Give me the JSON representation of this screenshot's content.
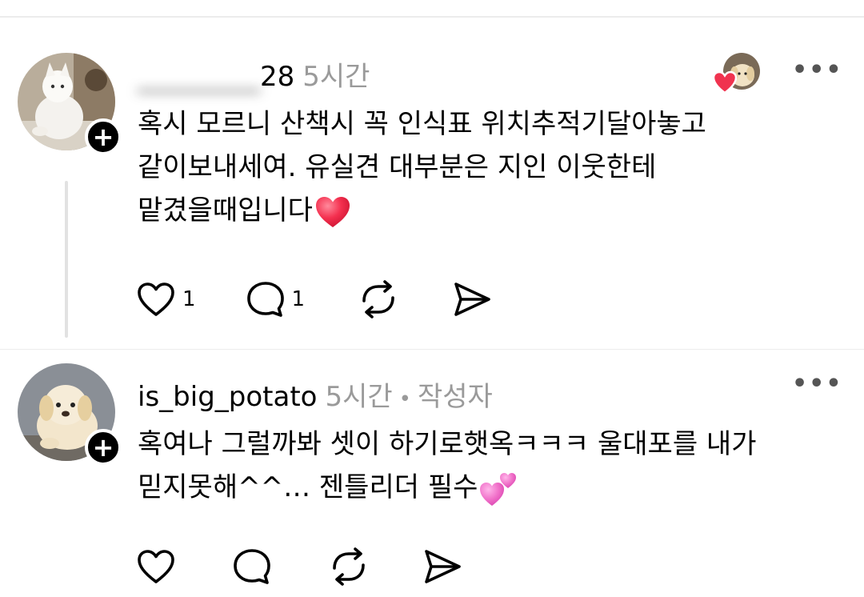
{
  "comments": [
    {
      "username_visible_tail": "28",
      "username_blurred": "_________",
      "time": "5시간",
      "lines": [
        "혹시 모르니 산책시 꼭 인식표 위치추적기달아놓고",
        "같이보내세여. 유실견 대부분은 지인 이웃한테",
        "맡겼을때입니다"
      ],
      "line3_emoji": "red-heart",
      "likes": "1",
      "replies": "1"
    },
    {
      "username": "is_big_potato",
      "time": "5시간",
      "author_badge": "작성자",
      "lines": [
        "혹여나 그럴까봐 셋이 하기로햇옥ㅋㅋㅋ 울대포를 내가",
        "믿지못해^^… 젠틀리더 필수"
      ],
      "line2_emoji": "two-hearts"
    }
  ],
  "icons": {
    "more": "•••",
    "plus": "+",
    "like": "heart-outline-icon",
    "reply": "speech-bubble-icon",
    "repost": "repost-icon",
    "share": "send-icon"
  },
  "colors": {
    "meta_gray": "#9a9a9a",
    "heart_red": "#f0334f",
    "heart_pink": "#f06fc8"
  }
}
